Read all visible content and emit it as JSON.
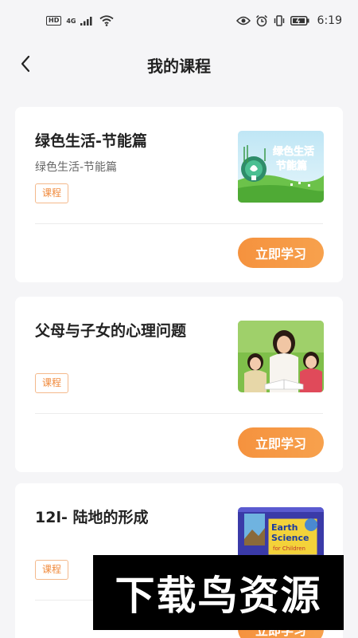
{
  "status_bar": {
    "hd": "HD",
    "network": "4G",
    "time": "6:19"
  },
  "header": {
    "title": "我的课程",
    "back_icon": "chevron-left-icon"
  },
  "courses": [
    {
      "title": "绿色生活-节能篇",
      "subtitle": "绿色生活-节能篇",
      "tag": "课程",
      "thumb_text": [
        "绿色生活",
        "节能篇"
      ],
      "button": "立即学习"
    },
    {
      "title": "父母与子女的心理问题",
      "subtitle": "",
      "tag": "课程",
      "button": "立即学习"
    },
    {
      "title": "12l- 陆地的形成",
      "subtitle": "",
      "tag": "课程",
      "thumb_text": [
        "Earth",
        "Science",
        "for Children"
      ],
      "button": "立即学习"
    }
  ],
  "watermark": "下载鸟资源",
  "colors": {
    "accent": "#f5923e",
    "tag_border": "#f4b98c",
    "background": "#f5f5f7"
  }
}
